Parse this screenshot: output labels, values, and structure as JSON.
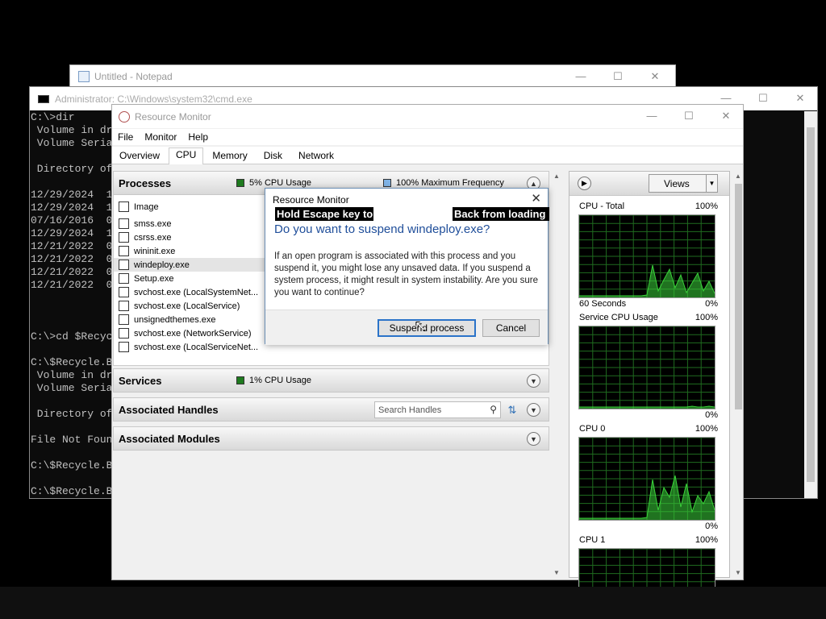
{
  "notepad": {
    "title": "Untitled - Notepad",
    "ctrl_min": "—",
    "ctrl_max": "☐",
    "ctrl_close": "✕"
  },
  "cmd": {
    "title": "Administrator: C:\\Windows\\system32\\cmd.exe",
    "ctrl_min": "—",
    "ctrl_max": "☐",
    "ctrl_close": "✕",
    "lines": [
      "C:\\>dir",
      " Volume in dr",
      " Volume Seria",
      "",
      " Directory of",
      "",
      "12/29/2024  1",
      "12/29/2024  1",
      "07/16/2016  0",
      "12/29/2024  1",
      "12/21/2022  0",
      "12/21/2022  0",
      "12/21/2022  0",
      "12/21/2022  0",
      "",
      "",
      "",
      "C:\\>cd $Recyc",
      "",
      "C:\\$Recycle.B",
      " Volume in dr",
      " Volume Seria",
      "",
      " Directory of",
      "",
      "File Not Foun",
      "",
      "C:\\$Recycle.B",
      "",
      "C:\\$Recycle.B"
    ]
  },
  "resmon": {
    "title": "Resource Monitor",
    "ctrl_min": "—",
    "ctrl_max": "☐",
    "ctrl_close": "✕",
    "menu": [
      "File",
      "Monitor",
      "Help"
    ],
    "tabs": [
      "Overview",
      "CPU",
      "Memory",
      "Disk",
      "Network"
    ],
    "active_tab": "CPU",
    "processes": {
      "title": "Processes",
      "cpu_usage": "5% CPU Usage",
      "max_freq": "100% Maximum Frequency",
      "header_image": "Image",
      "items": [
        "smss.exe",
        "csrss.exe",
        "wininit.exe",
        "windeploy.exe",
        "Setup.exe",
        "svchost.exe (LocalSystemNet...",
        "svchost.exe (LocalService)",
        "unsignedthemes.exe",
        "svchost.exe (NetworkService)",
        "svchost.exe (LocalServiceNet..."
      ],
      "selected": "windeploy.exe"
    },
    "services": {
      "title": "Services",
      "cpu_usage": "1% CPU Usage"
    },
    "handles": {
      "title": "Associated Handles",
      "search_placeholder": "Search Handles"
    },
    "modules": {
      "title": "Associated Modules"
    },
    "graphs_panel": {
      "views_label": "Views",
      "graphs": [
        {
          "title": "CPU - Total",
          "max": "100%",
          "footer": "60 Seconds",
          "min": "0%"
        },
        {
          "title": "Service CPU Usage",
          "max": "100%",
          "footer": "",
          "min": "0%"
        },
        {
          "title": "CPU 0",
          "max": "100%",
          "footer": "",
          "min": "0%"
        },
        {
          "title": "CPU 1",
          "max": "100%",
          "footer": "",
          "min": ""
        }
      ]
    }
  },
  "dialog": {
    "title": "Resource Monitor",
    "close": "✕",
    "overlay_left": "Hold Escape key to",
    "overlay_right": "Back from loading",
    "heading": "Do you want to suspend windeploy.exe?",
    "body": "If an open program is associated with this process and you suspend it, you might lose any unsaved data. If you suspend a system process, it might result in system instability. Are you sure you want to continue?",
    "suspend_label": "Suspend process",
    "cancel_label": "Cancel"
  },
  "colors": {
    "graph_bg": "#000000",
    "graph_grid": "#1f6b1f",
    "graph_line": "#3ad13a",
    "accent": "#1f4e9a"
  }
}
